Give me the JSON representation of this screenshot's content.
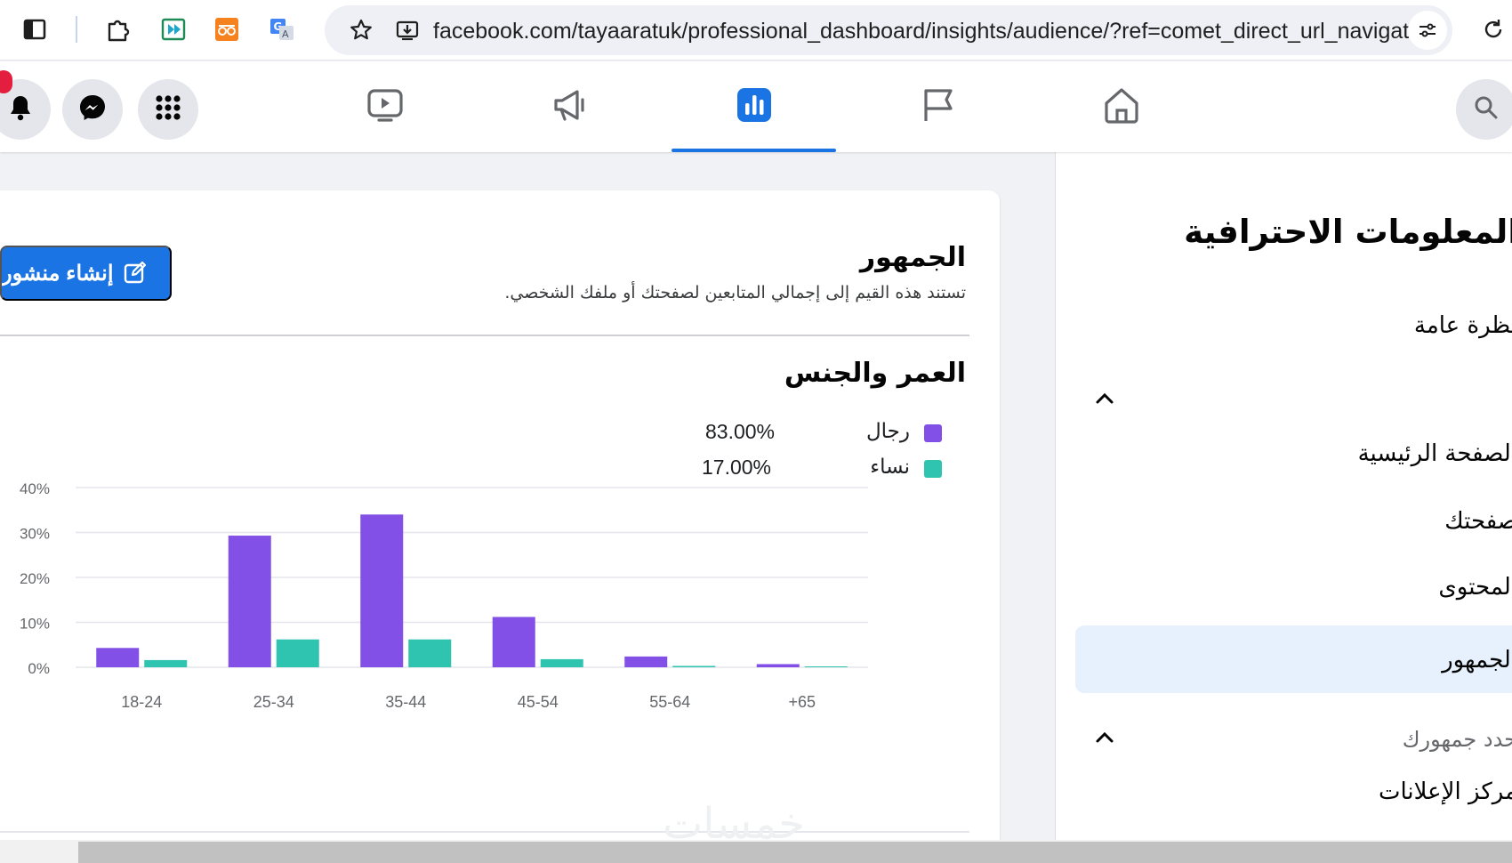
{
  "browser": {
    "url": "facebook.com/tayaaratuk/professional_dashboard/insights/audience/?ref=comet_direct_url_navigati..."
  },
  "nav": {
    "tabs": [
      {
        "name": "video",
        "icon": "video-icon"
      },
      {
        "name": "ads",
        "icon": "megaphone-icon"
      },
      {
        "name": "insights",
        "icon": "bar-chart-icon",
        "active": true
      },
      {
        "name": "pages",
        "icon": "flag-icon"
      },
      {
        "name": "home",
        "icon": "home-icon"
      }
    ],
    "accent": "#1b74e4"
  },
  "sidebar": {
    "title": "المعلومات الاحترافية",
    "items": [
      {
        "label": "نظرة عامة"
      },
      {
        "label": "الصفحة الرئيسية"
      },
      {
        "label": "صفحتك"
      },
      {
        "label": "المحتوى"
      },
      {
        "label": "الجمهور",
        "active": true
      },
      {
        "label": "حدد جمهورك"
      },
      {
        "label": "مركز الإعلانات"
      }
    ]
  },
  "main": {
    "create_post_label": "إنشاء منشور",
    "title": "الجمهور",
    "subtitle": "تستند هذه القيم إلى إجمالي المتابعين لصفحتك أو ملفك الشخصي.",
    "section_title": "العمر والجنس",
    "legend": [
      {
        "label": "رجال",
        "value": "83.00%",
        "color": "#8250e6"
      },
      {
        "label": "نساء",
        "value": "17.00%",
        "color": "#2ec4b0"
      }
    ]
  },
  "watermark": "خمسات",
  "chart_data": {
    "type": "bar",
    "categories": [
      "18-24",
      "25-34",
      "35-44",
      "45-54",
      "55-64",
      "+65"
    ],
    "series": [
      {
        "name": "رجال",
        "values": [
          4.3,
          29.3,
          34.0,
          11.2,
          2.4,
          0.7
        ],
        "color": "#8250e6"
      },
      {
        "name": "نساء",
        "values": [
          1.6,
          6.2,
          6.2,
          1.8,
          0.3,
          0.2
        ],
        "color": "#2ec4b0"
      }
    ],
    "ylim": [
      0,
      40
    ],
    "yticks": [
      "0%",
      "10%",
      "20%",
      "30%",
      "40%"
    ],
    "grid": true
  }
}
